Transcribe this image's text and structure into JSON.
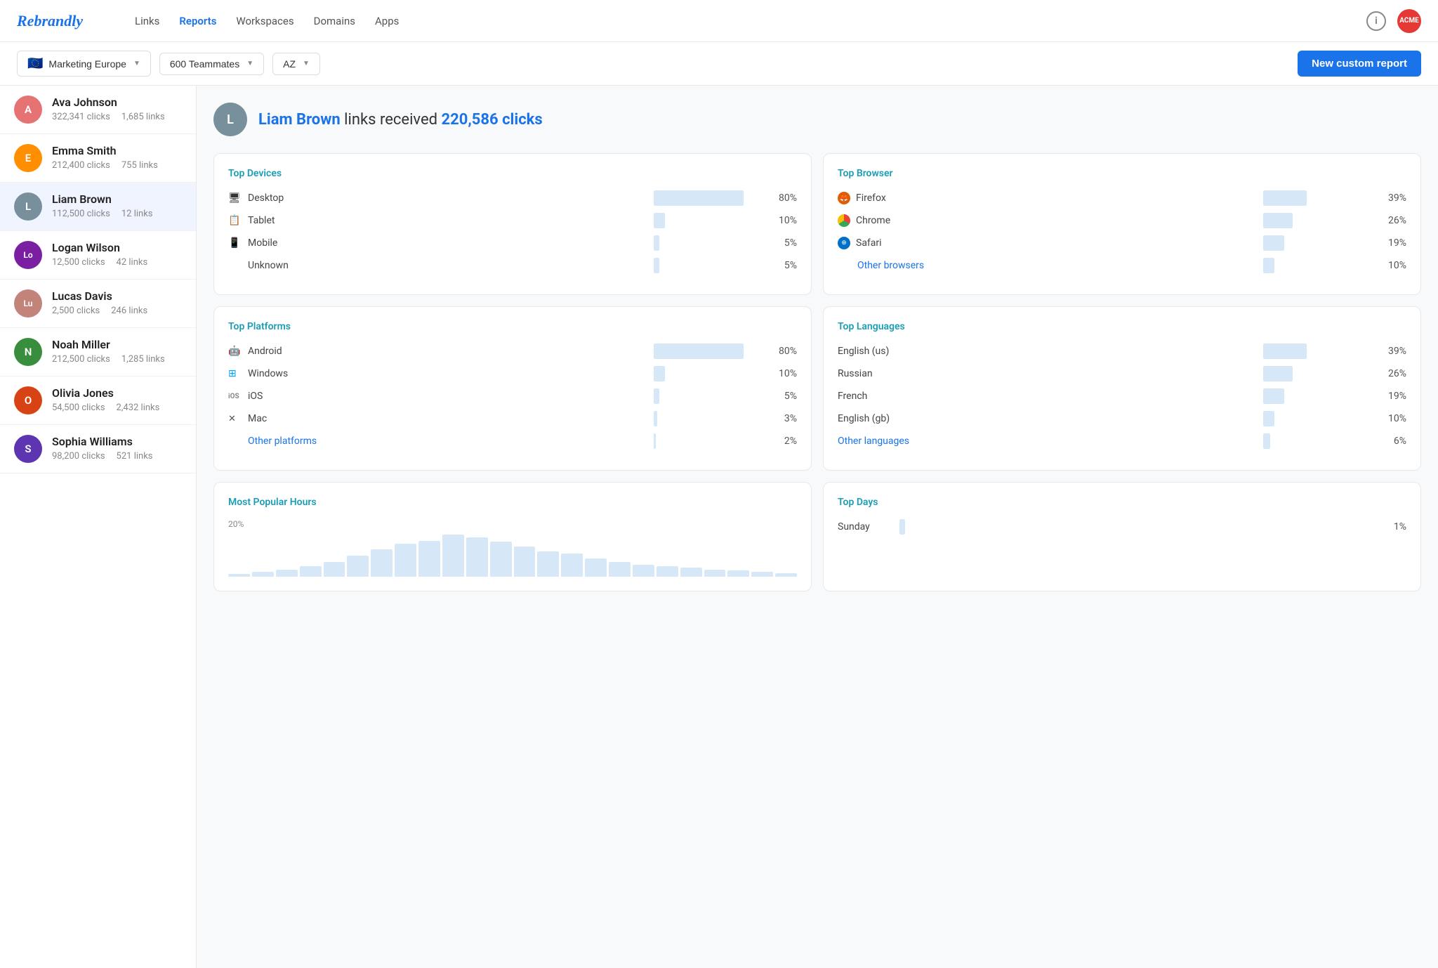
{
  "brand": "Rebrandly",
  "nav": {
    "links": [
      {
        "label": "Links",
        "active": false
      },
      {
        "label": "Reports",
        "active": true
      },
      {
        "label": "Workspaces",
        "active": false
      },
      {
        "label": "Domains",
        "active": false
      },
      {
        "label": "Apps",
        "active": false
      }
    ]
  },
  "toolbar": {
    "workspace": "Marketing Europe",
    "teammates": "600 Teammates",
    "filter": "AZ",
    "new_report_label": "New custom report"
  },
  "users": [
    {
      "id": 1,
      "name": "Ava Johnson",
      "clicks": "322,341 clicks",
      "links": "1,685 links",
      "av": "av-1",
      "initial": "A"
    },
    {
      "id": 2,
      "name": "Emma Smith",
      "clicks": "212,400 clicks",
      "links": "755 links",
      "av": "av-2",
      "initial": "E"
    },
    {
      "id": 3,
      "name": "Liam Brown",
      "clicks": "112,500 clicks",
      "links": "12 links",
      "av": "av-3",
      "initial": "L",
      "active": true
    },
    {
      "id": 4,
      "name": "Logan Wilson",
      "clicks": "12,500 clicks",
      "links": "42 links",
      "av": "av-4",
      "initial": "Lo"
    },
    {
      "id": 5,
      "name": "Lucas Davis",
      "clicks": "2,500 clicks",
      "links": "246 links",
      "av": "av-5",
      "initial": "Lu"
    },
    {
      "id": 6,
      "name": "Noah Miller",
      "clicks": "212,500 clicks",
      "links": "1,285 links",
      "av": "av-6",
      "initial": "N"
    },
    {
      "id": 7,
      "name": "Olivia Jones",
      "clicks": "54,500 clicks",
      "links": "2,432 links",
      "av": "av-7",
      "initial": "O"
    },
    {
      "id": 8,
      "name": "Sophia Williams",
      "clicks": "98,200 clicks",
      "links": "521 links",
      "av": "av-8",
      "initial": "S"
    }
  ],
  "selected": {
    "name": "Liam Brown",
    "prefix": "links received",
    "clicks": "220,586 clicks"
  },
  "top_devices": {
    "title": "Top Devices",
    "items": [
      {
        "icon": "🖥",
        "label": "Desktop",
        "pct": "80%",
        "bar": 80
      },
      {
        "icon": "📋",
        "label": "Tablet",
        "pct": "10%",
        "bar": 10
      },
      {
        "icon": "📱",
        "label": "Mobile",
        "pct": "5%",
        "bar": 5
      },
      {
        "icon": "",
        "label": "Unknown",
        "pct": "5%",
        "bar": 5
      }
    ]
  },
  "top_browser": {
    "title": "Top Browser",
    "items": [
      {
        "type": "firefox",
        "label": "Firefox",
        "pct": "39%",
        "bar": 39
      },
      {
        "type": "chrome",
        "label": "Chrome",
        "pct": "26%",
        "bar": 26
      },
      {
        "type": "safari",
        "label": "Safari",
        "pct": "19%",
        "bar": 19
      }
    ],
    "other_label": "Other browsers",
    "other_pct": "10%",
    "other_bar": 10
  },
  "top_platforms": {
    "title": "Top Platforms",
    "items": [
      {
        "type": "android",
        "label": "Android",
        "pct": "80%",
        "bar": 80
      },
      {
        "type": "windows",
        "label": "Windows",
        "pct": "10%",
        "bar": 10
      },
      {
        "type": "ios",
        "label": "iOS",
        "pct": "5%",
        "bar": 5
      },
      {
        "type": "mac",
        "label": "Mac",
        "pct": "3%",
        "bar": 3
      }
    ],
    "other_label": "Other platforms",
    "other_pct": "2%",
    "other_bar": 2
  },
  "top_languages": {
    "title": "Top Languages",
    "items": [
      {
        "label": "English (us)",
        "pct": "39%",
        "bar": 39
      },
      {
        "label": "Russian",
        "pct": "26%",
        "bar": 26
      },
      {
        "label": "French",
        "pct": "19%",
        "bar": 19
      },
      {
        "label": "English (gb)",
        "pct": "10%",
        "bar": 10
      }
    ],
    "other_label": "Other languages",
    "other_pct": "6%",
    "other_bar": 6
  },
  "popular_hours": {
    "title": "Most Popular Hours",
    "pct_label": "20%",
    "bars": [
      5,
      8,
      12,
      18,
      25,
      35,
      45,
      55,
      60,
      70,
      65,
      58,
      50,
      42,
      38,
      30,
      25,
      20,
      18,
      15,
      12,
      10,
      8,
      6
    ]
  },
  "top_days": {
    "title": "Top Days",
    "items": [
      {
        "label": "Sunday",
        "pct": "1%",
        "bar": 5
      }
    ]
  },
  "acme": "ACME"
}
